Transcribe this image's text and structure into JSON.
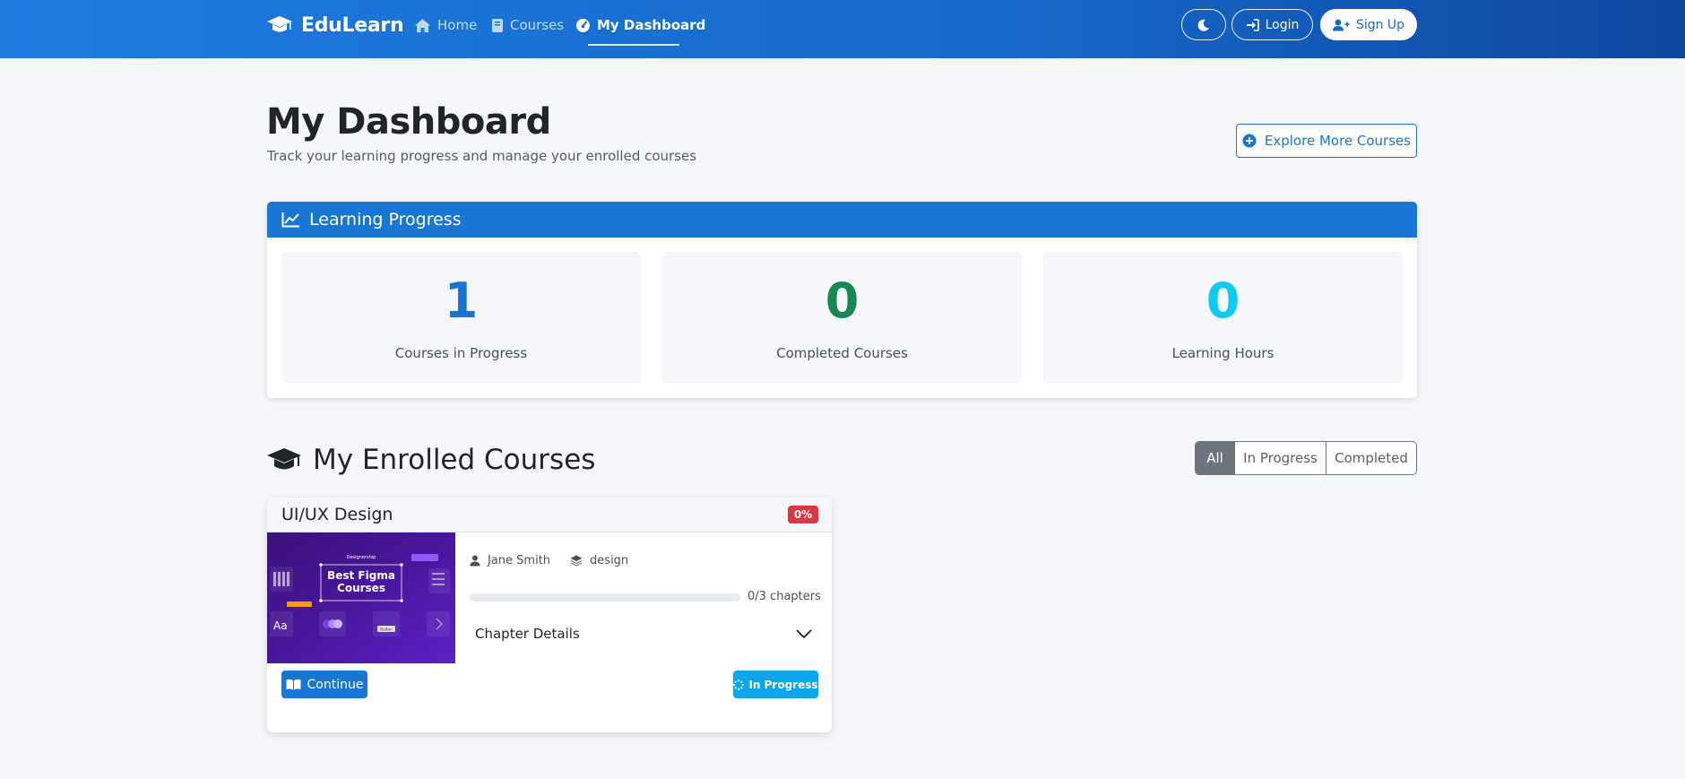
{
  "nav": {
    "brand": "EduLearn",
    "links": [
      {
        "label": "Home"
      },
      {
        "label": "Courses"
      },
      {
        "label": "My Dashboard"
      }
    ],
    "login": "Login",
    "signup": "Sign Up"
  },
  "header": {
    "title": "My Dashboard",
    "subtitle": "Track your learning progress and manage your enrolled courses",
    "explore": "Explore More Courses"
  },
  "progress": {
    "title": "Learning Progress",
    "stats": [
      {
        "value": "1",
        "label": "Courses in Progress",
        "color": "#1a73d4"
      },
      {
        "value": "0",
        "label": "Completed Courses",
        "color": "#198754"
      },
      {
        "value": "0",
        "label": "Learning Hours",
        "color": "#0dcaf0"
      }
    ]
  },
  "enrolled": {
    "title": "My Enrolled Courses",
    "filters": [
      "All",
      "In Progress",
      "Completed"
    ],
    "active_filter": "All"
  },
  "course": {
    "title": "UI/UX Design",
    "percent": "0%",
    "progress_fraction": 0,
    "instructor": "Jane Smith",
    "category": "design",
    "chapters": "0/3 chapters",
    "chapter_details": "Chapter Details",
    "continue": "Continue",
    "status": "In Progress",
    "thumb": {
      "brand": "Designership",
      "line1": "Best Figma",
      "line2": "Courses",
      "aa": "Aa",
      "button": "Button"
    }
  },
  "colors": {
    "primary": "#1976d2",
    "danger": "#dc3545",
    "info": "#0ea5e9",
    "success": "#198754"
  }
}
